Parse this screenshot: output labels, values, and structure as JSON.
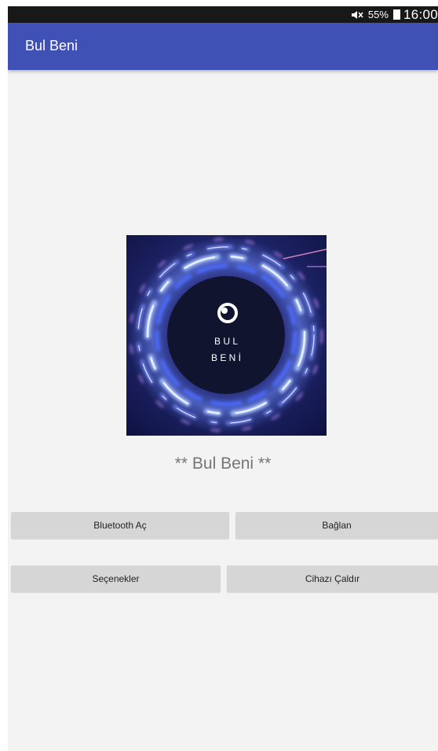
{
  "status_bar": {
    "battery": "55%",
    "time": "16:00",
    "icons": [
      "mute-icon",
      "battery-icon"
    ]
  },
  "app_bar": {
    "title": "Bul Beni"
  },
  "logo": {
    "line1": "B U L",
    "line2": "B E N İ",
    "icons": [
      "eye-icon"
    ],
    "colors": {
      "ring": "#4a6cff",
      "center": "#10142e",
      "background": "#1b1f5c"
    }
  },
  "main": {
    "app_name": "** Bul Beni **"
  },
  "buttons": {
    "bluetooth": "Bluetooth Aç",
    "connect": "Bağlan",
    "options": "Seçenekler",
    "ring_device": "Cihazı Çaldır"
  },
  "colors": {
    "primary": "#3f51b5",
    "background": "#f3f3f3",
    "button": "#d6d6d6"
  }
}
